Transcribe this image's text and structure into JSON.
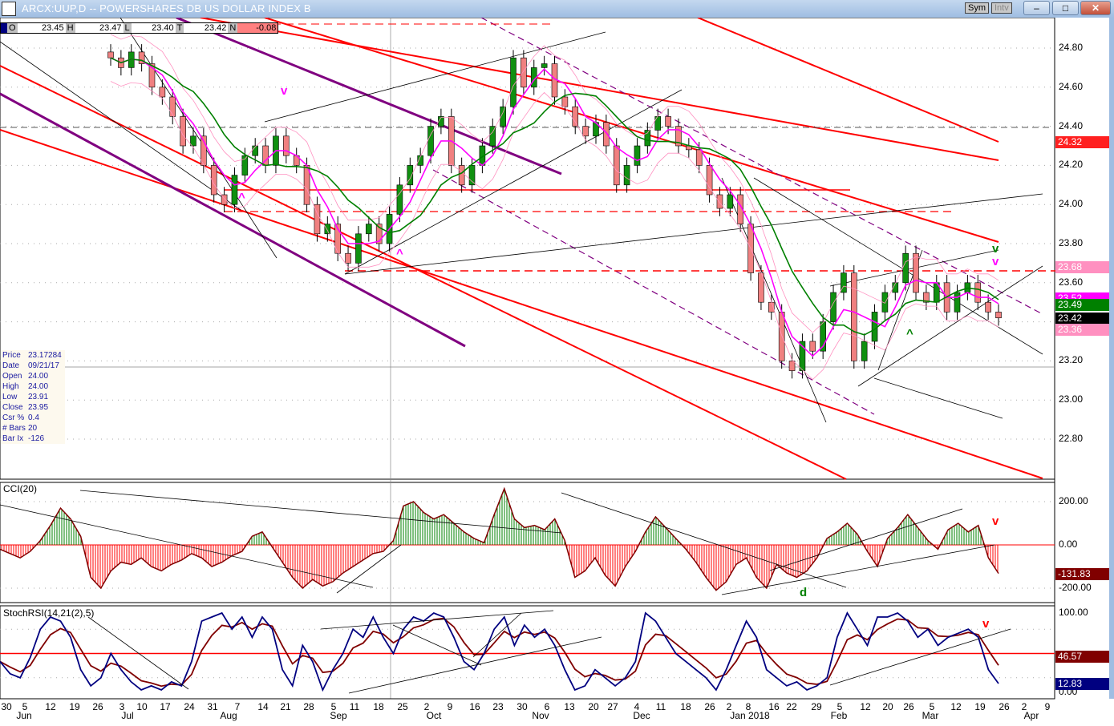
{
  "window": {
    "title": "ARCX:UUP,D -- POWERSHARES DB US DOLLAR INDEX B",
    "sym_label": "Sym",
    "intv_label": "Intv",
    "minimize": "–",
    "maximize": "□",
    "close": "✕"
  },
  "ohlc": {
    "o_label": "O",
    "o": "23.45",
    "h_label": "H",
    "h": "23.47",
    "l_label": "L",
    "l": "23.40",
    "t_label": "T",
    "t": "23.42",
    "n_label": "N",
    "n": "-0.08"
  },
  "info": [
    [
      "Price",
      "23.17284"
    ],
    [
      "Date",
      "09/21/17"
    ],
    [
      "Open",
      "24.00"
    ],
    [
      "High",
      "24.00"
    ],
    [
      "Low",
      "23.91"
    ],
    [
      "Close",
      "23.95"
    ],
    [
      "Csr %",
      "0.4"
    ],
    [
      "# Bars",
      "20"
    ],
    [
      "Bar Ix",
      "-126"
    ]
  ],
  "colors": {
    "up": "#109010",
    "down": "#f08080",
    "ma_fast": "#ff00ff",
    "ma_slow": "#008000",
    "band": "#ff90c0",
    "channel": "#ff0000",
    "purple": "#800080",
    "cci_pos": "#008000",
    "cci_neg": "#ff0000",
    "stoch_k": "#000080",
    "stoch_d": "#800000"
  },
  "chart_data": [
    {
      "type": "candlestick",
      "title": "ARCX:UUP,D",
      "ylim": [
        22.6,
        25.0
      ],
      "yticks": [
        "24.80",
        "24.60",
        "24.40",
        "24.20",
        "24.00",
        "23.80",
        "23.60",
        "23.40",
        "23.20",
        "23.00",
        "22.80"
      ],
      "closes": [
        24.75,
        24.7,
        24.78,
        24.72,
        24.6,
        24.55,
        24.45,
        24.3,
        24.35,
        24.2,
        24.05,
        24.0,
        24.15,
        24.25,
        24.3,
        24.2,
        24.35,
        24.25,
        24.2,
        24.0,
        23.85,
        23.9,
        23.75,
        23.7,
        23.85,
        23.9,
        23.8,
        23.95,
        24.1,
        24.2,
        24.25,
        24.4,
        24.45,
        24.2,
        24.1,
        24.2,
        24.3,
        24.4,
        24.5,
        24.75,
        24.6,
        24.7,
        24.72,
        24.55,
        24.5,
        24.4,
        24.35,
        24.42,
        24.3,
        24.1,
        24.2,
        24.3,
        24.38,
        24.45,
        24.4,
        24.3,
        24.28,
        24.2,
        24.05,
        23.98,
        24.05,
        23.9,
        23.65,
        23.5,
        23.45,
        23.2,
        23.15,
        23.3,
        23.25,
        23.4,
        23.55,
        23.65,
        23.2,
        23.3,
        23.45,
        23.55,
        23.6,
        23.75,
        23.55,
        23.5,
        23.6,
        23.45,
        23.55,
        23.6,
        23.5,
        23.45,
        23.42
      ],
      "levels": [
        {
          "value": "24.32",
          "color": "#ff2020",
          "text": "#fff"
        },
        {
          "value": "23.68",
          "color": "#ff90c0",
          "text": "#fff"
        },
        {
          "value": "23.52",
          "color": "#ff00ff",
          "text": "#fff"
        },
        {
          "value": "23.49",
          "color": "#008000",
          "text": "#fff"
        },
        {
          "value": "23.42",
          "color": "#000000",
          "text": "#fff"
        },
        {
          "value": "23.36",
          "color": "#ff90c0",
          "text": "#fff"
        }
      ],
      "annotations": [
        {
          "text": "v",
          "color": "#ff00ff"
        },
        {
          "text": "^",
          "color": "#ff00ff"
        },
        {
          "text": "^",
          "color": "#ff00ff"
        },
        {
          "text": "v",
          "color": "#008000"
        },
        {
          "text": "v",
          "color": "#ff00ff"
        },
        {
          "text": "^",
          "color": "#008000"
        }
      ]
    },
    {
      "type": "bar",
      "title": "CCI(20)",
      "ylim": [
        -280,
        280
      ],
      "yticks": [
        "200.00",
        "0.00",
        "-200.00"
      ],
      "last": "-131.83",
      "values": [
        -20,
        -40,
        -60,
        -30,
        20,
        90,
        170,
        120,
        40,
        -150,
        -200,
        -120,
        -80,
        -90,
        -60,
        -100,
        -120,
        -90,
        -70,
        -40,
        -60,
        -100,
        -80,
        -50,
        -30,
        40,
        60,
        -10,
        -80,
        -150,
        -200,
        -160,
        -190,
        -170,
        -130,
        -100,
        -70,
        -40,
        -30,
        20,
        180,
        200,
        150,
        120,
        140,
        100,
        60,
        30,
        10,
        140,
        260,
        120,
        80,
        90,
        70,
        120,
        20,
        -150,
        -120,
        -60,
        -140,
        -190,
        -100,
        -30,
        60,
        130,
        80,
        30,
        -20,
        -80,
        -150,
        -210,
        -170,
        -90,
        -60,
        -150,
        -200,
        -90,
        -130,
        -150,
        -120,
        -60,
        30,
        60,
        100,
        50,
        -30,
        -100,
        30,
        80,
        140,
        80,
        20,
        -20,
        70,
        100,
        60,
        90,
        -60,
        -131.83
      ],
      "annotations": [
        {
          "text": "v",
          "color": "#ff0000"
        },
        {
          "text": "d",
          "color": "#008000"
        }
      ]
    },
    {
      "type": "line",
      "title": "StochRSI(14,21(2),5)",
      "ylim": [
        0,
        100
      ],
      "yticks": [
        "100.00",
        "0.00"
      ],
      "last_d": "46.57",
      "last_k": "12.83",
      "k": [
        40,
        25,
        20,
        45,
        80,
        95,
        90,
        70,
        30,
        10,
        20,
        50,
        30,
        15,
        5,
        10,
        5,
        15,
        10,
        40,
        90,
        95,
        100,
        80,
        95,
        70,
        95,
        80,
        30,
        10,
        60,
        40,
        5,
        30,
        50,
        80,
        70,
        95,
        70,
        50,
        80,
        95,
        90,
        100,
        95,
        70,
        40,
        30,
        50,
        80,
        95,
        60,
        85,
        70,
        80,
        60,
        30,
        5,
        10,
        30,
        20,
        10,
        20,
        40,
        100,
        90,
        70,
        50,
        40,
        30,
        20,
        5,
        30,
        60,
        90,
        70,
        30,
        20,
        10,
        15,
        5,
        10,
        20,
        70,
        100,
        80,
        60,
        95,
        95,
        100,
        90,
        70,
        80,
        60,
        70,
        75,
        80,
        70,
        30,
        12.83
      ],
      "annotations": [
        {
          "text": "v",
          "color": "#ff0000"
        }
      ]
    }
  ],
  "xaxis": {
    "days": [
      "30",
      "5",
      "12",
      "19",
      "26",
      "3",
      "10",
      "17",
      "24",
      "31",
      "7",
      "14",
      "21",
      "28",
      "5",
      "11",
      "18",
      "25",
      "2",
      "9",
      "16",
      "23",
      "30",
      "6",
      "13",
      "20",
      "27",
      "4",
      "11",
      "18",
      "26",
      "2",
      "8",
      "16",
      "22",
      "29",
      "5",
      "12",
      "20",
      "26",
      "5",
      "12",
      "19",
      "26",
      "2",
      "9"
    ],
    "months": [
      "Jun",
      "Jul",
      "Aug",
      "Sep",
      "Oct",
      "Nov",
      "Dec",
      "Jan 2018",
      "Feb",
      "Mar",
      "Apr"
    ]
  }
}
